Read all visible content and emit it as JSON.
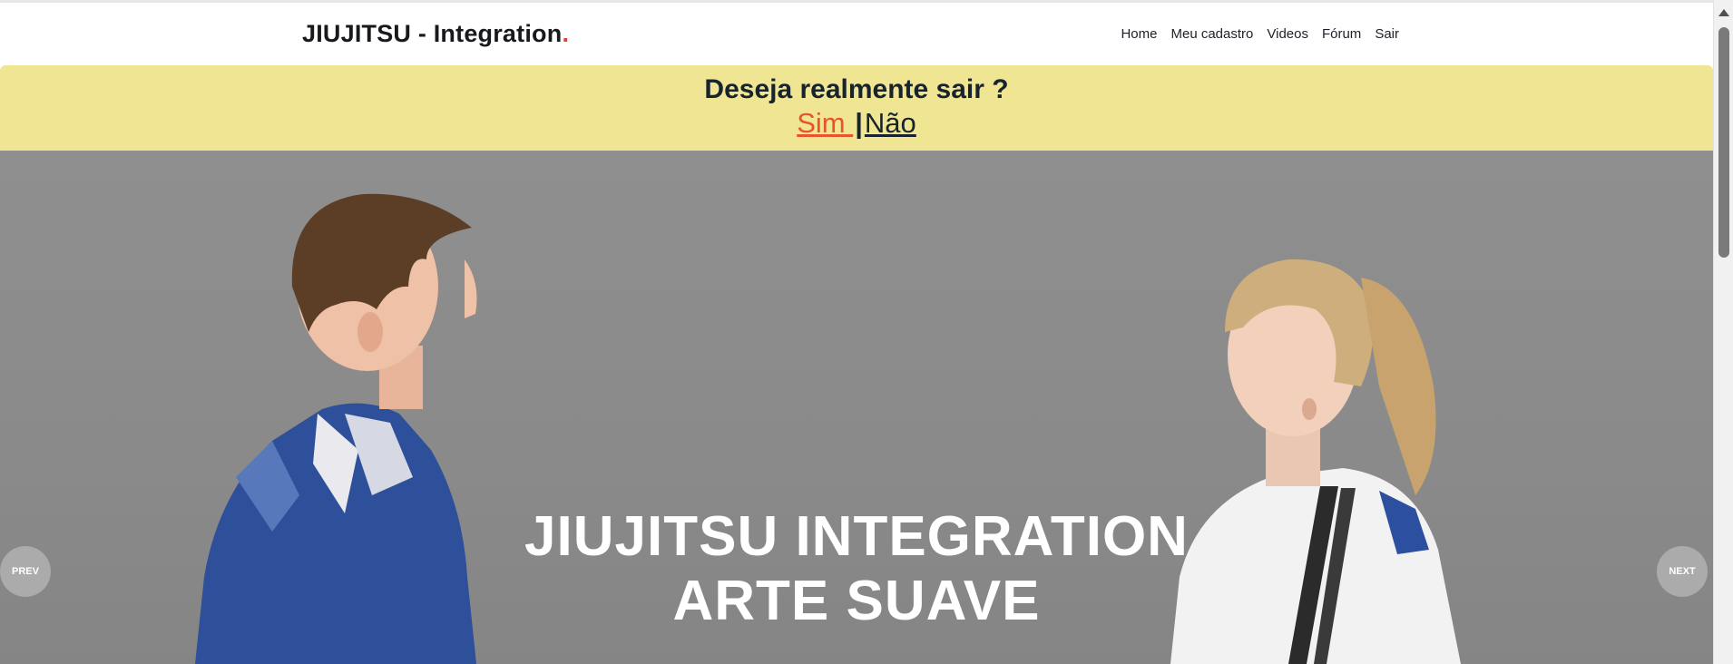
{
  "header": {
    "brand": "JIUJITSU - Integration",
    "brand_dot": ".",
    "nav": [
      "Home",
      "Meu cadastro",
      "Videos",
      "Fórum",
      "Sair"
    ]
  },
  "confirm": {
    "question": "Deseja realmente sair ?",
    "yes_label": "Sim ",
    "separator": "|",
    "no_label": "Não"
  },
  "hero": {
    "title_line1": "JIUJITSU INTEGRATION",
    "title_line2": "ARTE SUAVE",
    "prev_label": "PREV",
    "next_label": "NEXT"
  },
  "colors": {
    "accent": "#e8402a",
    "banner_bg": "#efe592",
    "yes_link": "#e8542c",
    "text_dark": "#17232d"
  },
  "icons": [
    "scroll-up-arrow-icon"
  ]
}
